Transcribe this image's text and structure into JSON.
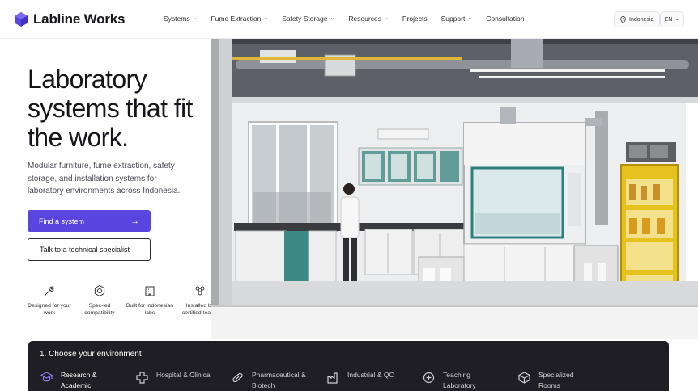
{
  "brand": {
    "name": "Labline Works",
    "color": "#5b45e0"
  },
  "nav": {
    "items": [
      {
        "label": "Systems",
        "dropdown": true
      },
      {
        "label": "Fume Extraction",
        "dropdown": true
      },
      {
        "label": "Safety Storage",
        "dropdown": true
      },
      {
        "label": "Resources",
        "dropdown": true
      },
      {
        "label": "Projects",
        "dropdown": false
      },
      {
        "label": "Support",
        "dropdown": true
      },
      {
        "label": "Consultation",
        "dropdown": false
      }
    ],
    "chevron": "⌄",
    "region": {
      "label": "Indonesia",
      "icon": "location-pin-icon"
    },
    "language": {
      "label": "EN",
      "icon": "chevron-down-icon"
    }
  },
  "hero": {
    "title": "Laboratory systems that fit the work.",
    "subtitle": "Modular furniture, fume extraction, safety storage, and installation systems for laboratory environments across Indonesia.",
    "primary_cta": "Find a system",
    "primary_arrow": "→",
    "secondary_cta": "Talk to a technical specialist"
  },
  "features": [
    {
      "label": "Designed for your work",
      "icon": "pipette-icon"
    },
    {
      "label": "Spec-led compatibility",
      "icon": "gear-hex-icon"
    },
    {
      "label": "Built for Indonesian labs",
      "icon": "building-icon"
    },
    {
      "label": "Installed by certified teams",
      "icon": "molecule-icon"
    }
  ],
  "environment": {
    "title": "1. Choose your environment",
    "options": [
      {
        "label": "Research & Academic",
        "icon": "graduation-icon",
        "active": true
      },
      {
        "label": "Hospital & Clinical",
        "icon": "medical-cross-icon",
        "active": false
      },
      {
        "label": "Pharmaceutical & Biotech",
        "icon": "capsule-icon",
        "active": false
      },
      {
        "label": "Industrial & QC",
        "icon": "factory-icon",
        "active": false
      },
      {
        "label": "Teaching Laboratory",
        "icon": "teaching-icon",
        "active": false
      },
      {
        "label": "Specialized Rooms",
        "icon": "cube-icon",
        "active": false
      }
    ]
  }
}
